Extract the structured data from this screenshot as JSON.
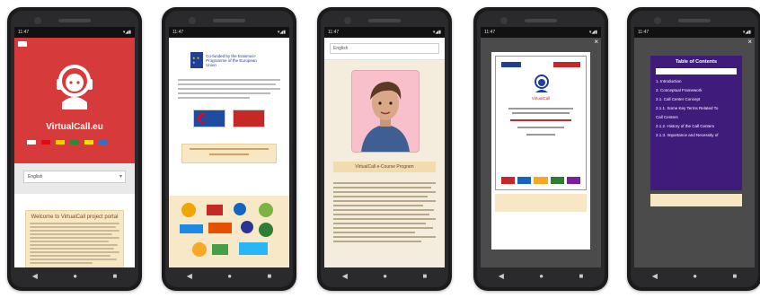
{
  "phones": [
    {
      "status": {
        "time": "11:47",
        "icons": "▾◢▮"
      },
      "brand": "VirtualCall.eu",
      "language_value": "English",
      "welcome_title": "Welcome to VirtualCall project portal"
    },
    {
      "status": {
        "time": "11:47",
        "icons": "▾◢▮"
      },
      "eu_text": "Co-funded by the Erasmus+ Programme of the European Union"
    },
    {
      "status": {
        "time": "11:47",
        "icons": "▾◢▮"
      },
      "language_value": "English",
      "section_title": "VirtualCall e-Course Program"
    },
    {
      "status": {
        "time": "11:47",
        "icons": "▾◢▮"
      },
      "close": "×",
      "doc_brand": "VirtualCall"
    },
    {
      "status": {
        "time": "11:47",
        "icons": "▾◢▮"
      },
      "close": "×",
      "toc_title": "Table of Contents",
      "toc_items": [
        "1. Introduction",
        "2. Conceptual Framework",
        "2.1. Call Center Concept",
        "2.1.1. Some Key Terms Related To",
        "Call Centers",
        "2.1.2. History of the Call Centers",
        "2.1.3. Importance and Necessity of"
      ]
    }
  ],
  "nav": {
    "back": "◀",
    "home": "●",
    "recent": "■"
  },
  "colors": {
    "red_hero": "#d63a3a",
    "toc_purple": "#3f1b7a",
    "cream": "#f7e7c2"
  }
}
